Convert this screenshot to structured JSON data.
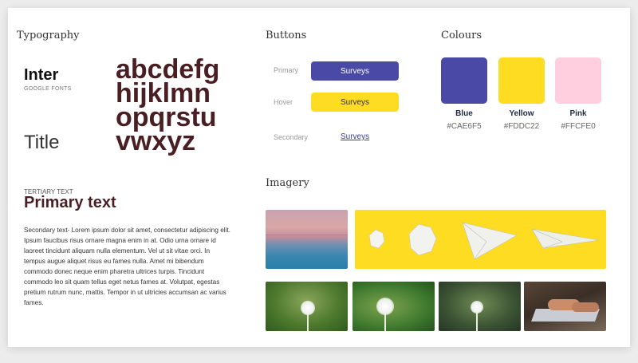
{
  "typography": {
    "section_title": "Typography",
    "font_name": "Inter",
    "font_source": "GOOGLE FONTS",
    "alphabet_line1": "abcdefg",
    "alphabet_line2": "hijklmn",
    "alphabet_line3": "opqrstu",
    "alphabet_line4": "vwxyz",
    "title_sample": "Title",
    "tertiary": "TERTIARY TEXT",
    "primary": "Primary text",
    "secondary": "Secondary text- Lorem ipsum dolor sit amet, consectetur adipiscing elit. Ipsum faucibus risus ornare magna enim in at. Odio urna ornare id laoreet tincidunt aliquam nulla elementum. Vel ut sit vitae orci. In tempus augue aliquet risus eu fames nulla. Amet mi bibendum commodo donec neque enim pharetra ultrices turpis. Tincidunt commodo leo sit quam tellus eget netus fames at. Volutpat, egestas pretium rutrum nunc, mattis. Tempor in ut ultricies accumsan ac varius fames."
  },
  "buttons": {
    "section_title": "Buttons",
    "primary_label": "Primary",
    "primary_text": "Surveys",
    "hover_label": "Hover",
    "hover_text": "Surveys",
    "secondary_label": "Secondary",
    "secondary_text": "Surveys"
  },
  "colours": {
    "section_title": "Colours",
    "swatches": [
      {
        "name": "Blue",
        "hex": "#CAE6F5",
        "color": "#4A4AA6"
      },
      {
        "name": "Yellow",
        "hex": "#FDDC22",
        "color": "#FDDC22"
      },
      {
        "name": "Pink",
        "hex": "#FFCFE0",
        "color": "#FFCFE0"
      }
    ]
  },
  "imagery": {
    "section_title": "Imagery",
    "photos": [
      "sunset-sea",
      "paper-evolution",
      "dandelion-1",
      "dandelion-2",
      "dandelion-3",
      "typing-laptop"
    ]
  }
}
